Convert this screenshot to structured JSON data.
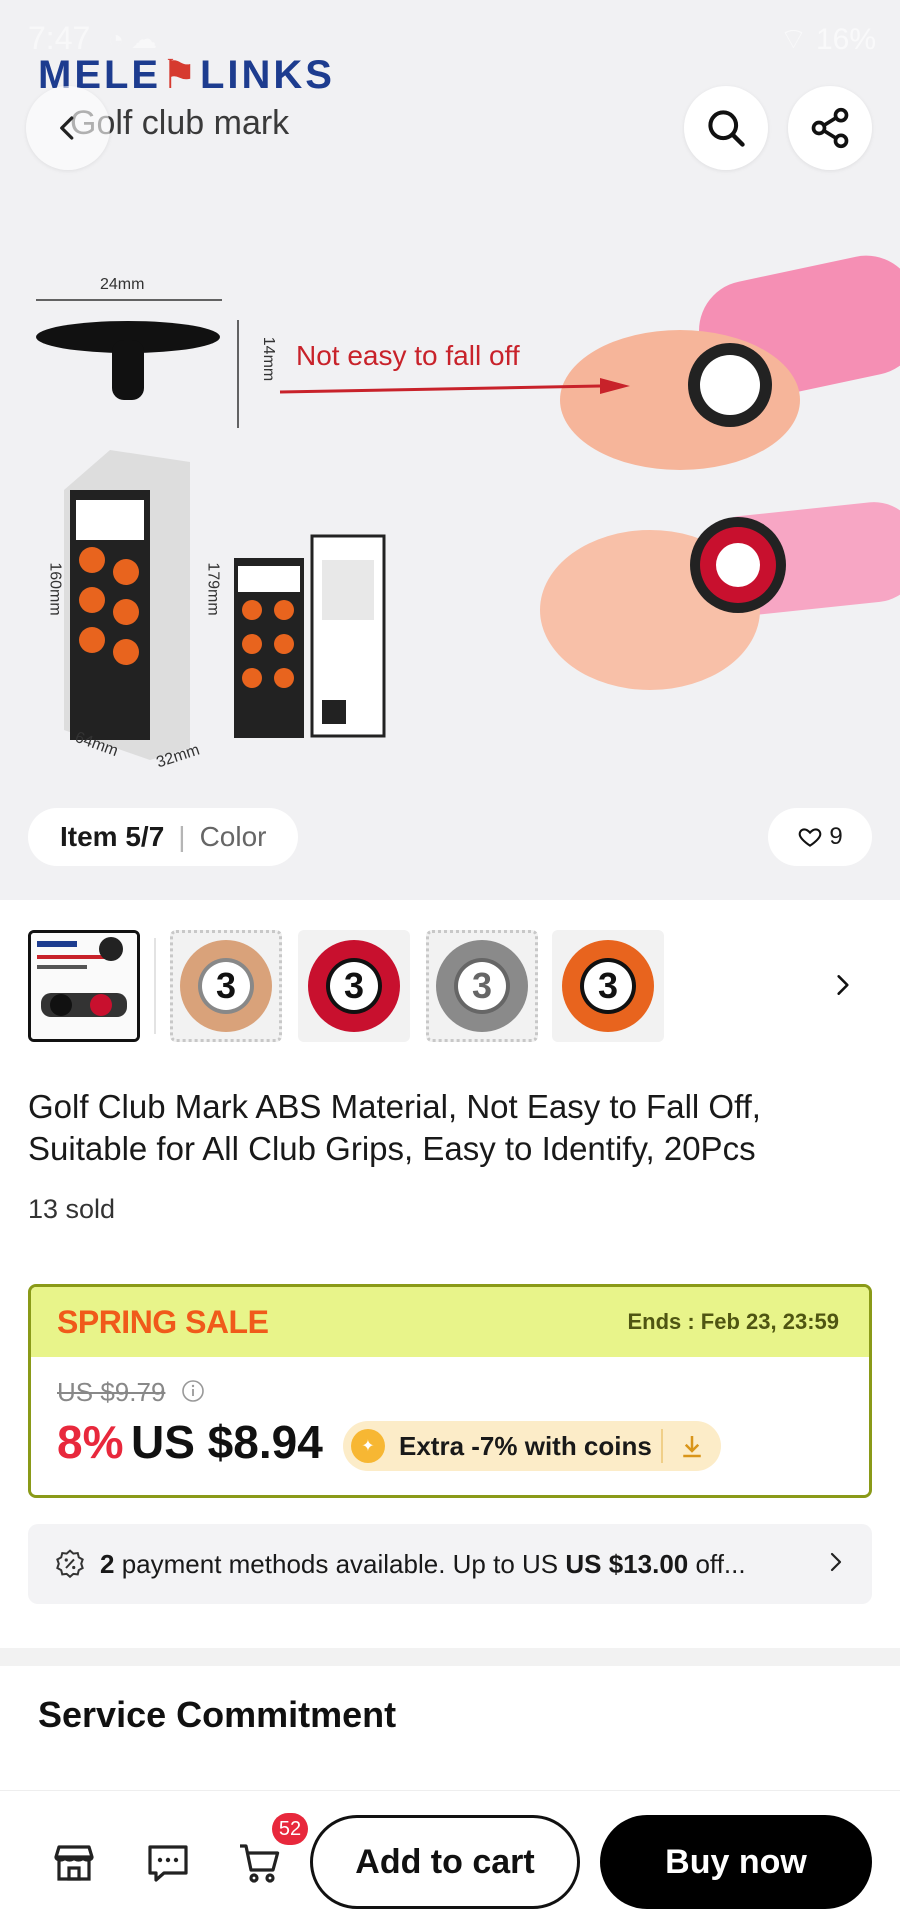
{
  "status_bar": {
    "time": "7:47",
    "battery": "16%"
  },
  "hero": {
    "brand": "MELE",
    "brand_suffix": "LINKS",
    "title": "Golf club mark",
    "dimensions": {
      "width": "24mm",
      "height": "14mm",
      "box_height": "160mm",
      "card_height": "179mm",
      "box_width": "64mm",
      "box_depth": "32mm"
    },
    "callout": "Not easy to fall off",
    "item_label": "Item 5/7",
    "variant_label": "Color",
    "favorites_count": "9"
  },
  "thumbnails": [
    {
      "name": "thumb-product-photo",
      "number": ""
    },
    {
      "name": "thumb-tan",
      "number": "3",
      "color": "#d9a27a"
    },
    {
      "name": "thumb-red",
      "number": "3",
      "color": "#c8102e"
    },
    {
      "name": "thumb-gray",
      "number": "3",
      "color": "#8a8a8a"
    },
    {
      "name": "thumb-orange",
      "number": "3",
      "color": "#e8641e"
    }
  ],
  "product": {
    "title": "Golf Club Mark ABS Material, Not Easy to Fall Off, Suitable for All Club Grips, Easy to Identify, 20Pcs",
    "sold": "13 sold"
  },
  "sale": {
    "label": "SPRING SALE",
    "ends": "Ends :  Feb 23, 23:59",
    "original_price": "US $9.79",
    "discount": "8%",
    "price": "US $8.94",
    "coins": "Extra -7% with coins",
    "accent_color": "#f05a1a",
    "header_bg": "#e8f48a"
  },
  "payment": {
    "count": "2",
    "text_pre": " payment methods available. Up to US ",
    "amount": "US $13.00",
    "text_post": " off..."
  },
  "service": {
    "title": "Service Commitment"
  },
  "bottom_bar": {
    "cart_count": "52",
    "add_to_cart": "Add to cart",
    "buy_now": "Buy now"
  }
}
